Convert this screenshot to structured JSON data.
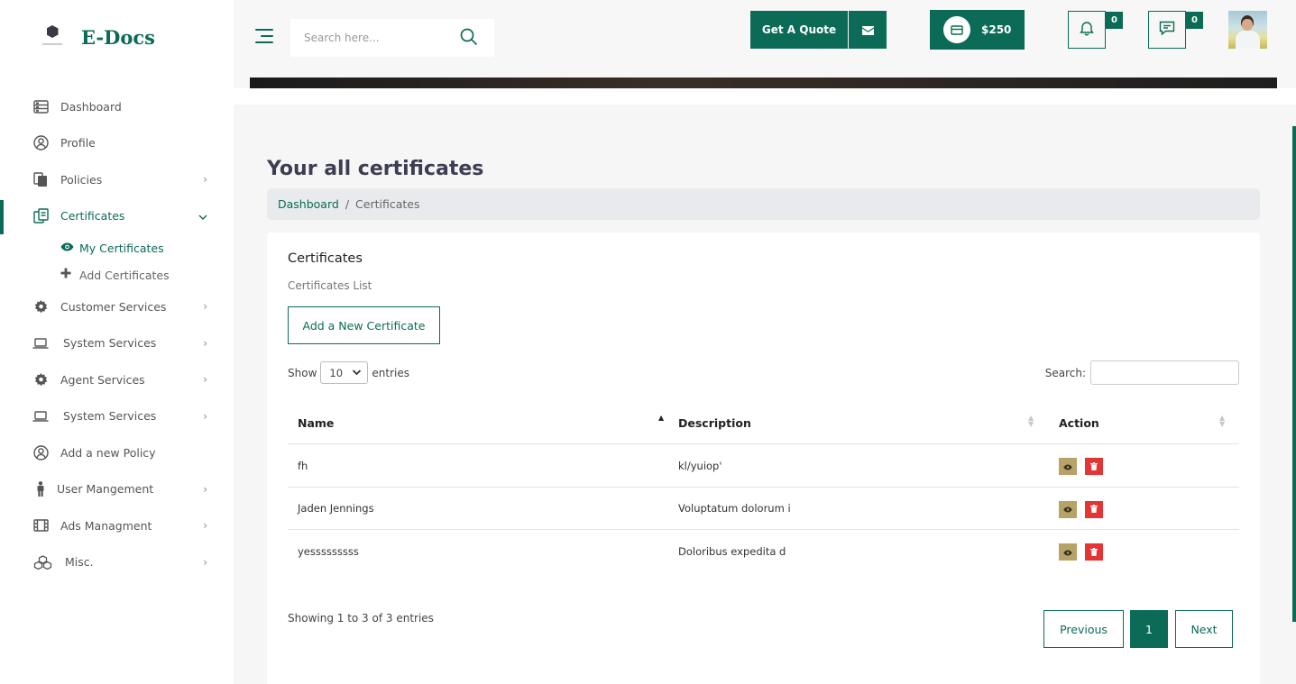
{
  "brand": {
    "name": "E-Docs"
  },
  "topbar": {
    "search_placeholder": "Search here...",
    "quote_label": "Get A Quote",
    "balance": "$250",
    "notifications_count": "0",
    "messages_count": "0"
  },
  "sidebar": {
    "items": [
      {
        "label": "Dashboard",
        "icon": "dashboard-icon"
      },
      {
        "label": "Profile",
        "icon": "profile-icon"
      },
      {
        "label": "Policies",
        "icon": "policies-icon",
        "chevron": ">"
      },
      {
        "label": "Certificates",
        "icon": "certificates-icon",
        "chevron": "v",
        "active": true
      },
      {
        "label": "Customer Services",
        "icon": "gear-icon",
        "chevron": ">"
      },
      {
        "label": "System Services",
        "icon": "laptop-icon",
        "chevron": ">"
      },
      {
        "label": "Agent Services",
        "icon": "gear-icon",
        "chevron": ">"
      },
      {
        "label": "System Services",
        "icon": "laptop-icon",
        "chevron": ">"
      },
      {
        "label": "Add a new Policy",
        "icon": "profile-icon"
      },
      {
        "label": "User Mangement",
        "icon": "user-icon",
        "chevron": ">"
      },
      {
        "label": "Ads Managment",
        "icon": "film-icon",
        "chevron": ">"
      },
      {
        "label": "Misc.",
        "icon": "cubes-icon",
        "chevron": ">"
      }
    ],
    "sub_items": [
      {
        "label": "My Certificates",
        "icon": "eye-icon"
      },
      {
        "label": "Add Certificates",
        "icon": "plus-icon"
      }
    ]
  },
  "page": {
    "title": "Your all certificates",
    "breadcrumb": {
      "home": "Dashboard",
      "separator": "/",
      "current": "Certificates"
    }
  },
  "card": {
    "title": "Certificates",
    "subtitle": "Certificates List",
    "add_button": "Add a New Certificate",
    "length": {
      "show": "Show",
      "value": "10",
      "entries": "entries"
    },
    "search_label": "Search:",
    "columns": [
      "Name",
      "Description",
      "Action"
    ],
    "rows": [
      {
        "name": "fh",
        "description": "kl/yuiop'"
      },
      {
        "name": "Jaden Jennings",
        "description": "Voluptatum dolorum i"
      },
      {
        "name": "yesssssssss",
        "description": "Doloribus expedita d"
      }
    ],
    "info": "Showing 1 to 3 of 3 entries",
    "pagination": {
      "previous": "Previous",
      "current": "1",
      "next": "Next"
    }
  },
  "colors": {
    "primary": "#0b6b56",
    "view": "#b7a268",
    "delete": "#e53434"
  }
}
